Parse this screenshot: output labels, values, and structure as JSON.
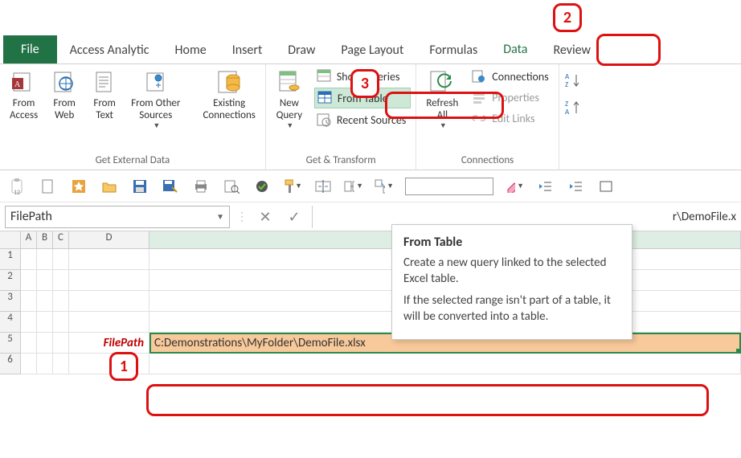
{
  "tabs": {
    "file": "File",
    "access": "Access Analytic",
    "home": "Home",
    "insert": "Insert",
    "draw": "Draw",
    "pagelayout": "Page Layout",
    "formulas": "Formulas",
    "data": "Data",
    "review": "Review"
  },
  "ribbon": {
    "ext": {
      "from_access": "From\nAccess",
      "from_web": "From\nWeb",
      "from_text": "From\nText",
      "from_other": "From Other\nSources",
      "existing": "Existing\nConnections",
      "label": "Get External Data"
    },
    "getx": {
      "new_query": "New\nQuery",
      "show_queries": "Show Queries",
      "from_table": "From Table",
      "recent": "Recent Sources",
      "label": "Get & Transform"
    },
    "conn": {
      "refresh": "Refresh\nAll",
      "connections": "Connections",
      "properties": "Properties",
      "edit_links": "Edit Links",
      "label": "Connections"
    }
  },
  "namebox": "FilePath",
  "formula": "r\\DemoFile.x",
  "columns": [
    "A",
    "B",
    "C",
    "D"
  ],
  "rows": [
    "1",
    "2",
    "3",
    "4",
    "5",
    "6"
  ],
  "cellD5_label": "FilePath",
  "cellE5_value": "C:Demonstrations\\MyFolder\\DemoFile.xlsx",
  "tooltip": {
    "title": "From Table",
    "p1": "Create a new query linked to the selected Excel table.",
    "p2": "If the selected range isn't part of a table, it will be converted into a table."
  },
  "annot": {
    "n1": "1",
    "n2": "2",
    "n3": "3"
  }
}
